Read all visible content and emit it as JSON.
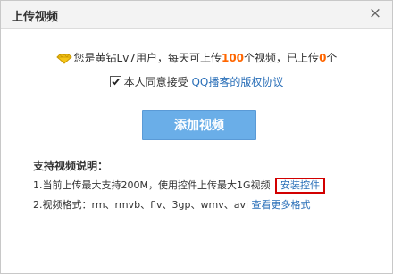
{
  "dialog": {
    "title": "上传视频",
    "close_symbol": "×"
  },
  "quota": {
    "prefix": "您是黄钻Lv7用户，每天可上传",
    "daily_limit": "100",
    "middle": "个视频，已上传",
    "uploaded": "0",
    "suffix": "个"
  },
  "agreement": {
    "checked": true,
    "text": "本人同意接受",
    "link_label": "QQ播客的版权协议"
  },
  "add_button_label": "添加视频",
  "description": {
    "title": "支持视频说明：",
    "line1_text": "1.当前上传最大支持200M，使用控件上传最大1G视频",
    "install_label": "安装控件",
    "line2_text": "2.视频格式：rm、rmvb、flv、3gp、wmv、avi",
    "more_formats_label": "查看更多格式"
  },
  "colors": {
    "accent_number": "#ff6600",
    "link": "#2a6fb8",
    "button": "#6aaee8",
    "highlight_border": "#d20000"
  },
  "icons": {
    "vip": "yellow-diamond-vip-icon",
    "checkbox": "checkbox-checked-icon",
    "close": "close-icon"
  }
}
